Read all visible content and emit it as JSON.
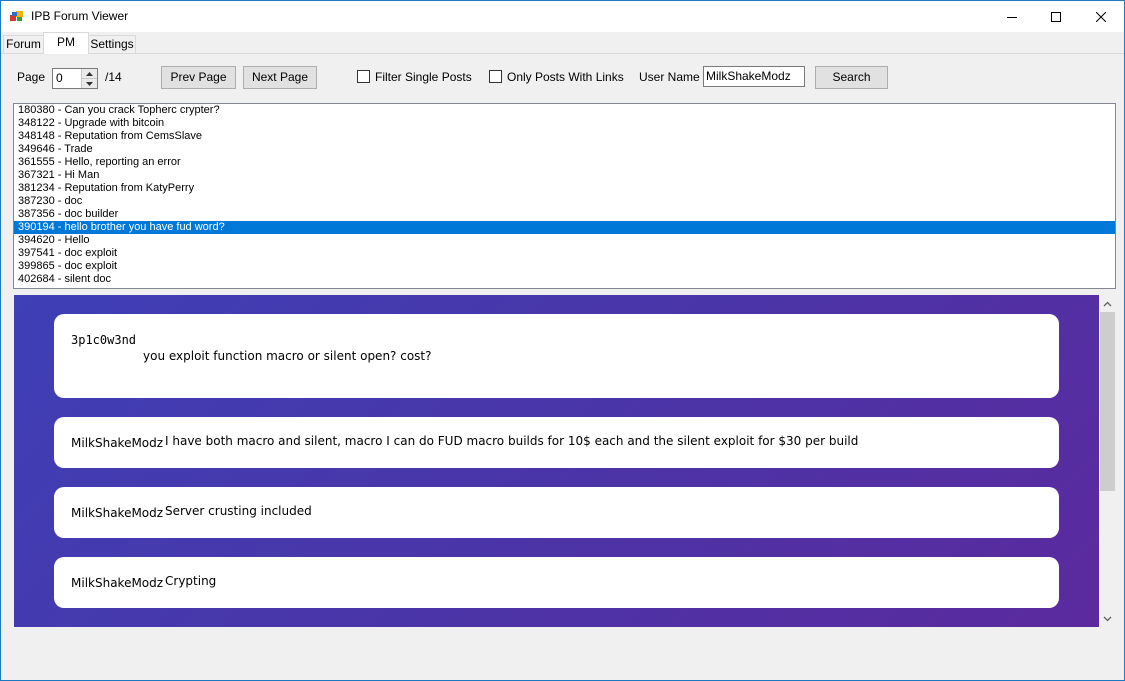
{
  "window": {
    "title": "IPB Forum Viewer",
    "controls": {
      "minimize_icon": "minimize-icon",
      "maximize_icon": "maximize-icon",
      "close_icon": "close-icon"
    }
  },
  "tabs": [
    {
      "label": "Forum",
      "active": false
    },
    {
      "label": "PM",
      "active": true
    },
    {
      "label": "Settings",
      "active": false
    }
  ],
  "toolbar": {
    "page_label": "Page",
    "page_value": "0",
    "page_total": "/14",
    "prev_label": "Prev Page",
    "next_label": "Next Page",
    "filter_single_label": "Filter Single Posts",
    "filter_single_checked": false,
    "only_links_label": "Only Posts With Links",
    "only_links_checked": false,
    "username_label": "User Name",
    "username_value": "MilkShakeModz",
    "search_label": "Search"
  },
  "threads": [
    "180380 - Can you crack Topherc crypter?",
    "348122 - Upgrade with bitcoin",
    "348148 - Reputation from CemsSlave",
    "349646 - Trade",
    "361555 - Hello, reporting an error",
    "367321 - Hi Man",
    "381234 - Reputation from KatyPerry",
    "387230 - doc",
    "387356 - doc builder",
    "390194 - hello brother you have fud word?",
    "394620 - Hello",
    "397541 - doc exploit",
    "399865 - doc exploit",
    "402684 - silent doc"
  ],
  "selected_thread_index": 9,
  "messages": [
    {
      "author": "3p1c0w3nd",
      "text": "you exploit function macro or silent open? cost?"
    },
    {
      "author": "MilkShakeModz",
      "text": "I have both macro and silent, macro I can do FUD macro builds for 10$ each and the silent exploit for $30 per build"
    },
    {
      "author": "MilkShakeModz",
      "text": "Server crusting included"
    },
    {
      "author": "MilkShakeModz",
      "text": "Crypting"
    }
  ],
  "colors": {
    "selection": "#0078d7",
    "chat_gradient_start": "#3f3fb6",
    "chat_gradient_end": "#5b2a9e"
  }
}
